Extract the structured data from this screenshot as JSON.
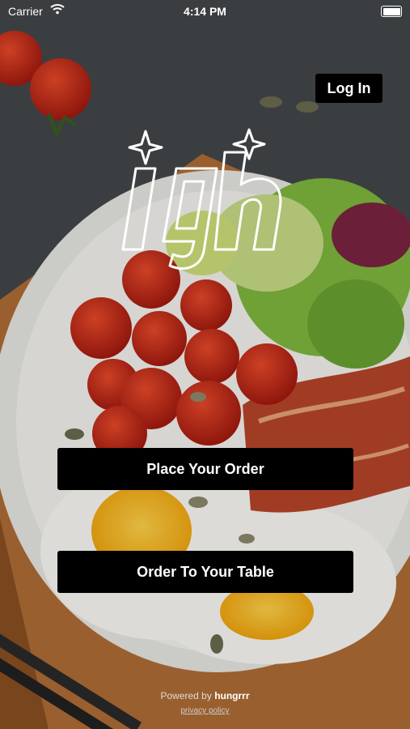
{
  "status_bar": {
    "carrier": "Carrier",
    "time": "4:14 PM"
  },
  "header": {
    "login_label": "Log In"
  },
  "logo": {
    "alt": "ign"
  },
  "actions": {
    "place_order_label": "Place Your Order",
    "table_order_label": "Order To Your Table"
  },
  "footer": {
    "powered_prefix": "Powered by",
    "brand": "hungrrr",
    "privacy_label": "privacy policy"
  },
  "colors": {
    "button_bg": "#000000",
    "button_text": "#ffffff"
  }
}
